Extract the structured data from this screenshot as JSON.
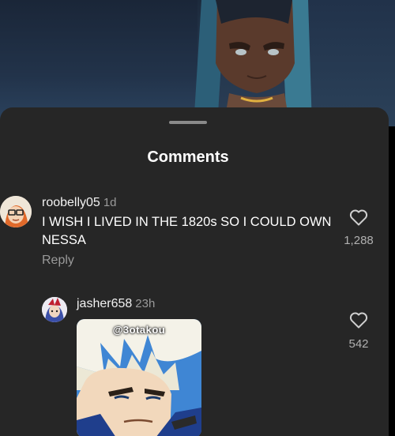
{
  "sheet": {
    "title": "Comments"
  },
  "comments": [
    {
      "username": "roobelly05",
      "time": "1d",
      "text": "I WISH I LIVED IN THE 1820s SO I COULD OWN NESSA",
      "reply_label": "Reply",
      "like_count": "1,288",
      "avatar_icon": "cartoon-avatar"
    },
    {
      "username": "jasher658",
      "time": "23h",
      "like_count": "542",
      "avatar_icon": "cartoon-avatar",
      "media_tag": "@3otakou"
    }
  ],
  "colors": {
    "sheet_bg": "#262626",
    "secondary_text": "#9a9a9a"
  }
}
